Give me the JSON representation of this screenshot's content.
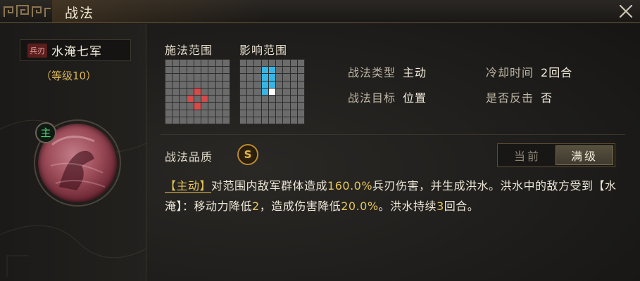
{
  "window": {
    "title": "战法"
  },
  "skill": {
    "type_tag": "兵刃",
    "name": "水淹七军",
    "level": "（等级10）",
    "badge": "主"
  },
  "ranges": {
    "cast_label": "施法范围",
    "effect_label": "影响范围"
  },
  "attributes": {
    "type_key": "战法类型",
    "type_val": "主动",
    "cooldown_key": "冷却时间",
    "cooldown_val": "2回合",
    "target_key": "战法目标",
    "target_val": "位置",
    "counter_key": "是否反击",
    "counter_val": "否"
  },
  "quality": {
    "label": "战法品质",
    "grade": "S"
  },
  "toggle": {
    "current": "当前",
    "max": "满级",
    "selected": "满级"
  },
  "description": {
    "tag": "【主动】",
    "p1": "对范围内敌军群体造成",
    "n1": "160.0%",
    "p2": "兵刃伤害，并生成洪水。洪水中的敌方受到【水淹】：移动力降低",
    "n2": "2",
    "p3": "，造成伤害降低",
    "n3": "20.0%",
    "p4": "。洪水持续",
    "n4": "3",
    "p5": "回合。"
  },
  "colors": {
    "accent_gold": "#e6c45a",
    "range_red": "#d64a4a",
    "range_blue": "#35b6e6"
  },
  "icons": {
    "close": "close-icon",
    "corner_ornament": "ornament-icon"
  }
}
